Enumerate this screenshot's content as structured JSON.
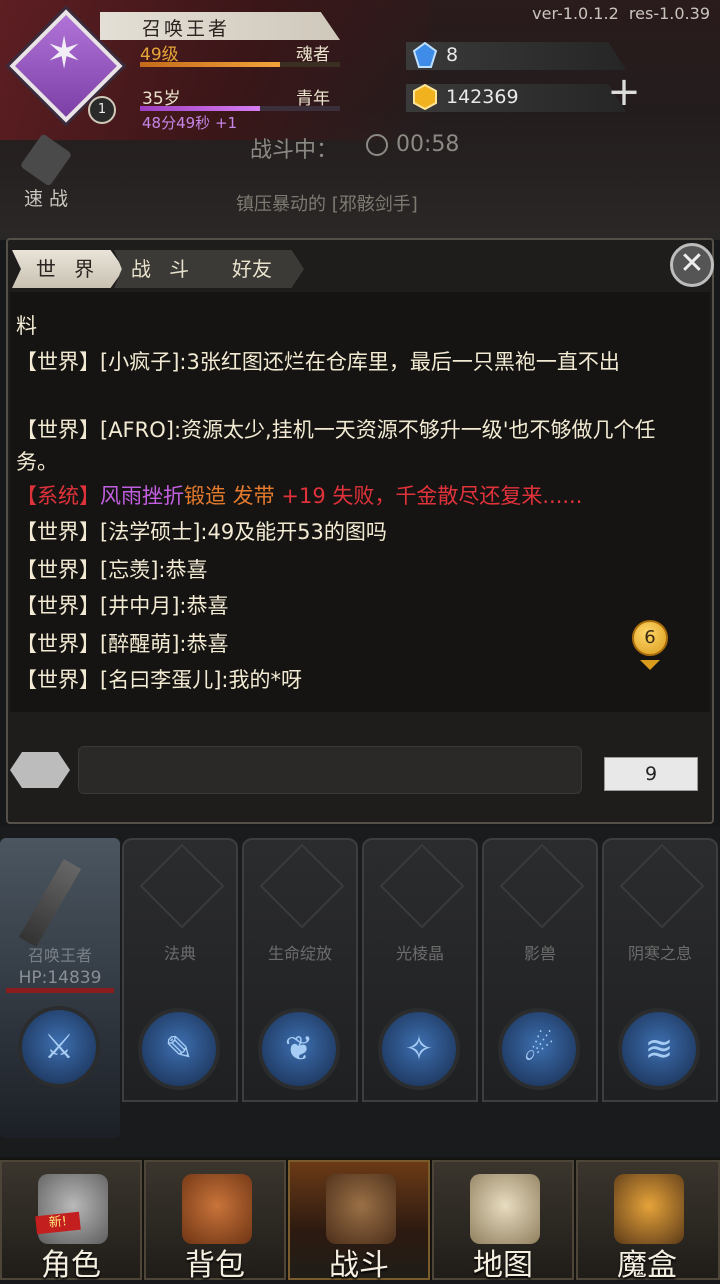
{
  "version": {
    "ver": "ver-1.0.1.2",
    "res": "res-1.0.39"
  },
  "player": {
    "avatar_badge": "1",
    "name": "召唤王者",
    "level": "49级",
    "soul": "魂者",
    "xp_progress": 0.7,
    "age": "35岁",
    "stage": "青年",
    "age_progress": 0.6,
    "age_timer": "48分49秒 +1"
  },
  "resources": {
    "gem": "8",
    "gold": "142369"
  },
  "battle": {
    "fast_label": "速 战",
    "status_label": "战斗中：",
    "timer": "00:58",
    "suppress_text": "镇压暴动的 [邪骸剑手]"
  },
  "chat": {
    "tabs": [
      "世 界",
      "战 斗",
      "好友"
    ],
    "messages": [
      {
        "tag": "【世界】",
        "name": "[小疯子]",
        "text": ":3张红图还烂在仓库里，最后一只黑袍一直不出"
      },
      {
        "tag": "【世界】",
        "name": "[AFRO]",
        "text": ":资源太少,挂机一天资源不够升一级'也不够做几个任务。"
      },
      {
        "tag": "【系统】",
        "name": "风雨挫折",
        "verb": "锻造",
        "item": " 发带 ",
        "text": "+19 失败，千金散尽还复来......"
      },
      {
        "tag": "【世界】",
        "name": "[法学硕士]",
        "text": ":49及能开53的图吗"
      },
      {
        "tag": "【世界】",
        "name": "[忘羡]",
        "text": ":恭喜"
      },
      {
        "tag": "【世界】",
        "name": "[井中月]",
        "text": ":恭喜"
      },
      {
        "tag": "【世界】",
        "name": "[醉醒萌]",
        "text": ":恭喜"
      },
      {
        "tag": "【世界】",
        "name": "[名曰李蛋儿]",
        "text": ":我的*呀"
      }
    ],
    "partial_top": "料",
    "unread_count": "6",
    "remaining_count": "9"
  },
  "skills": {
    "summoner": {
      "name": "召唤王者",
      "hp": "HP:14839"
    },
    "slots": [
      {
        "label": "法典",
        "icon": "book-icon"
      },
      {
        "label": "生命绽放",
        "icon": "leaf-icon"
      },
      {
        "label": "光棱晶",
        "icon": "beam-icon"
      },
      {
        "label": "影兽",
        "icon": "beast-icon"
      },
      {
        "label": "阴寒之息",
        "icon": "wave-icon"
      }
    ]
  },
  "nav": {
    "items": [
      {
        "label": "角色",
        "icon": "helmet-icon",
        "badge": "新!"
      },
      {
        "label": "背包",
        "icon": "backpack-icon"
      },
      {
        "label": "战斗",
        "icon": "sword-shield-icon"
      },
      {
        "label": "地图",
        "icon": "scroll-icon"
      },
      {
        "label": "魔盒",
        "icon": "magic-box-icon"
      }
    ],
    "active": "战斗"
  },
  "colors": {
    "world_tag": "#f2ead2",
    "system_tag": "#e0323a",
    "system_name": "#c25fe0",
    "system_verb": "#e57a2c",
    "xp_bar": "#f2a43a",
    "age_bar": "#d77ef2"
  }
}
